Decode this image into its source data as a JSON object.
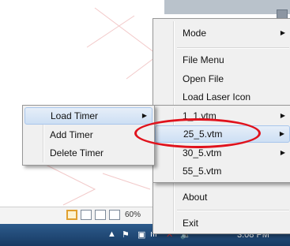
{
  "main_menu": {
    "items": [
      {
        "label": "Mode",
        "submenu": true
      },
      {
        "label": "File Menu",
        "submenu": false
      },
      {
        "label": "Open File",
        "submenu": false
      },
      {
        "label": "Load Laser Icon",
        "submenu": false
      },
      {
        "label": "About",
        "submenu": false
      },
      {
        "label": "Exit",
        "submenu": false
      }
    ]
  },
  "timer_menu": {
    "items": [
      {
        "label": "Load Timer",
        "submenu": true
      },
      {
        "label": "Add Timer",
        "submenu": false
      },
      {
        "label": "Delete Timer",
        "submenu": false
      }
    ]
  },
  "file_menu": {
    "items": [
      {
        "label": "1_1.vtm",
        "submenu": true
      },
      {
        "label": "25_5.vtm",
        "submenu": true
      },
      {
        "label": "30_5.vtm",
        "submenu": true
      },
      {
        "label": "55_5.vtm",
        "submenu": false
      }
    ]
  },
  "status_bar": {
    "zoom": "60%"
  },
  "taskbar": {
    "time": "3:08 PM"
  },
  "highlight_color": "#e0121c"
}
